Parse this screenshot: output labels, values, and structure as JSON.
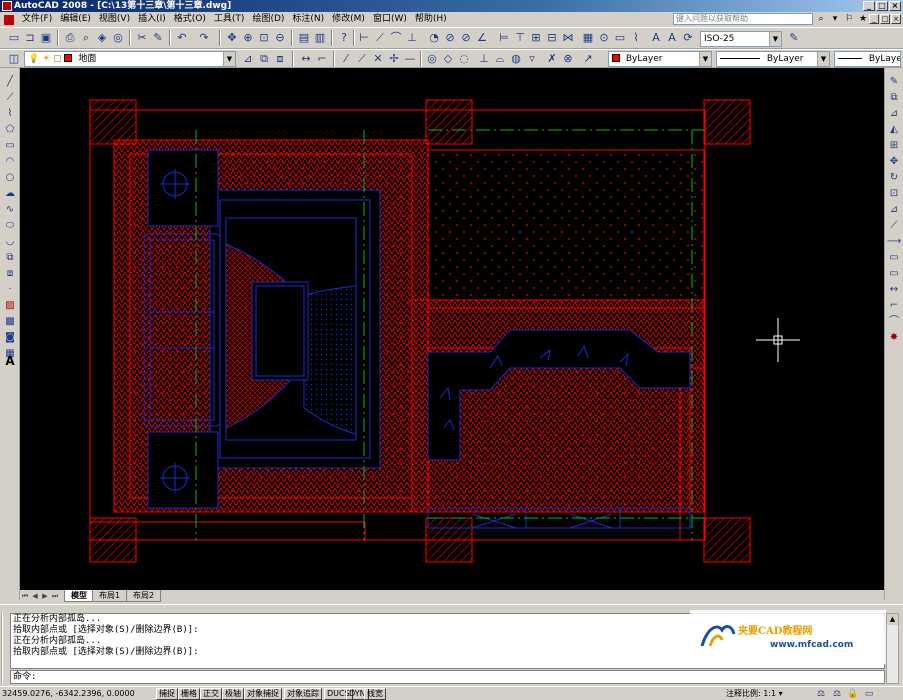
{
  "window": {
    "title": "AutoCAD 2008 - [C:\\13第十三章\\第十三章.dwg]",
    "controls": [
      "_",
      "□",
      "×"
    ]
  },
  "menu": {
    "items": [
      "文件(F)",
      "编辑(E)",
      "视图(V)",
      "插入(I)",
      "格式(O)",
      "工具(T)",
      "绘图(D)",
      "标注(N)",
      "修改(M)",
      "窗口(W)",
      "帮助(H)"
    ],
    "help_placeholder": "键入问题以获取帮助",
    "mdi_controls": [
      "_",
      "□",
      "×"
    ]
  },
  "toolbar_standard": {
    "dimstyle": "ISO-25"
  },
  "toolbar_layers": {
    "layer": "地面",
    "color": "ByLayer",
    "color_swatch": "#ff0000",
    "linetype": "ByLayer",
    "lineweight": "ByLayer"
  },
  "tabs": {
    "items": [
      "模型",
      "布局1",
      "布局2"
    ],
    "active": "模型"
  },
  "command": {
    "history": [
      "正在分析内部孤岛...",
      "拾取内部点或 [选择对象(S)/删除边界(B)]:",
      "正在分析内部孤岛...",
      "拾取内部点或 [选择对象(S)/删除边界(B)]:"
    ],
    "prompt": "命令:"
  },
  "watermark": {
    "title": "夹要CAD教程网",
    "url": "www.mfcad.com"
  },
  "status": {
    "coords": "32459.0276, -6342.2396, 0.0000",
    "toggles": [
      "捕捉",
      "栅格",
      "正交",
      "极轴",
      "对象捕捉",
      "对象追踪",
      "DUCS",
      "DYN",
      "线宽"
    ],
    "annotation_scale": "注释比例: 1:1 ▾"
  },
  "colors": {
    "canvas": "#000000",
    "hatch": "#ff0000",
    "furniture": "#1a2bd0",
    "centerline": "#00c000"
  }
}
